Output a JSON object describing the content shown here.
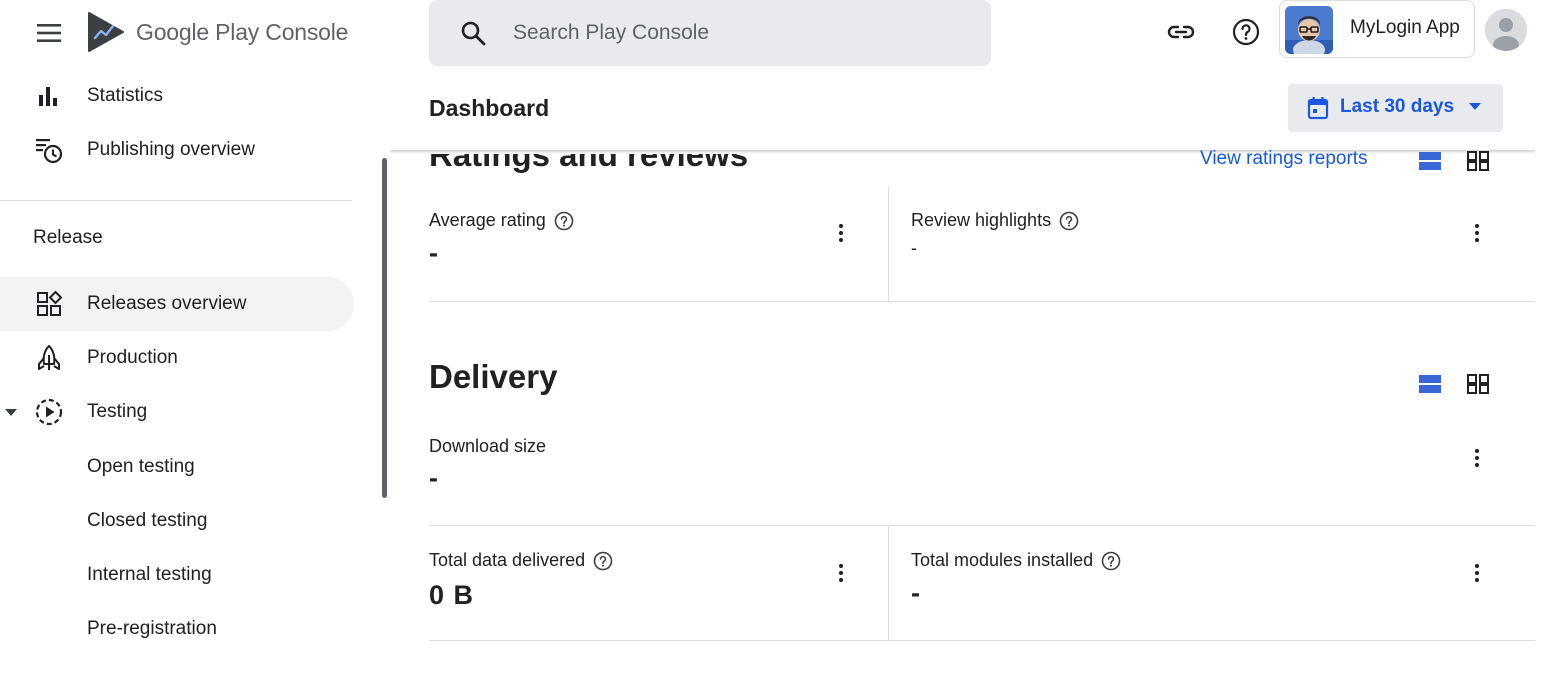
{
  "app": {
    "brand": "Google Play Console",
    "selected_app": "MyLogin App"
  },
  "search": {
    "placeholder": "Search Play Console"
  },
  "sidebar": {
    "top_items": [
      {
        "label": "Statistics",
        "icon": "bar-chart-icon"
      },
      {
        "label": "Publishing overview",
        "icon": "publishing-schedule-icon"
      }
    ],
    "section_heading": "Release",
    "items": [
      {
        "label": "Releases overview",
        "icon": "dashboard-grid-icon",
        "active": true
      },
      {
        "label": "Production",
        "icon": "rocket-icon"
      },
      {
        "label": "Testing",
        "icon": "testing-play-icon",
        "expanded": true
      }
    ],
    "testing_children": [
      {
        "label": "Open testing"
      },
      {
        "label": "Closed testing"
      },
      {
        "label": "Internal testing"
      },
      {
        "label": "Pre-registration"
      }
    ]
  },
  "header": {
    "title": "Dashboard",
    "date_range": "Last 30 days"
  },
  "ratings": {
    "title": "Ratings and reviews",
    "link": "View ratings reports",
    "average_rating_label": "Average rating",
    "average_rating_value": "-",
    "review_highlights_label": "Review highlights",
    "review_highlights_value": "-"
  },
  "delivery": {
    "title": "Delivery",
    "download_size_label": "Download size",
    "download_size_value": "-",
    "total_data_label": "Total data delivered",
    "total_data_value": "0 B",
    "total_modules_label": "Total modules installed",
    "total_modules_value": "-"
  },
  "colors": {
    "accent": "#1a57e0",
    "toggle_active": "#3b66d8",
    "chip_background": "#e8eaed",
    "active_nav": "#f1f3f4"
  }
}
